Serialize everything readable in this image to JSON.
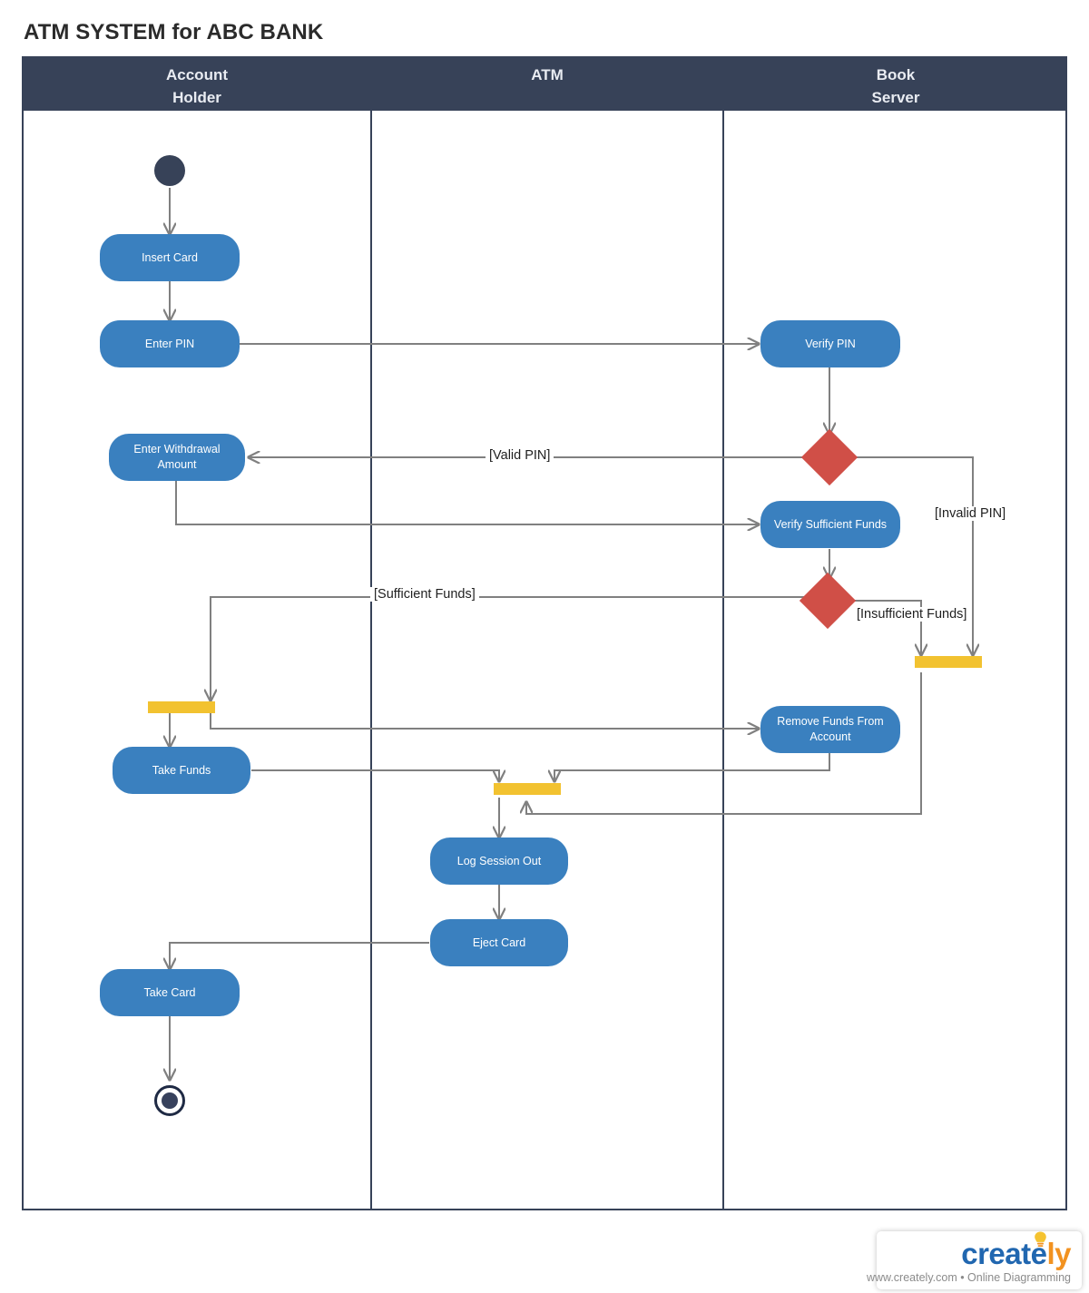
{
  "title": "ATM SYSTEM for ABC BANK",
  "colors": {
    "header_band": "#374258",
    "activity_fill": "#3a80bf",
    "decision_fill": "#d04f47",
    "bar_fill": "#f2c230",
    "connector": "#808080",
    "frame_border": "#374258",
    "logo_blue": "#2167b0",
    "logo_orange": "#f29220"
  },
  "lanes": [
    {
      "id": "account-holder",
      "label": "Account\nHolder"
    },
    {
      "id": "atm",
      "label": "ATM"
    },
    {
      "id": "book-server",
      "label": "Book\nServer"
    }
  ],
  "nodes": {
    "start": {
      "type": "initial-node",
      "lane": "account-holder"
    },
    "insert_card": {
      "label": "Insert Card",
      "lane": "account-holder"
    },
    "enter_pin": {
      "label": "Enter PIN",
      "lane": "account-holder"
    },
    "verify_pin": {
      "label": "Verify PIN",
      "lane": "book-server"
    },
    "decision_pin": {
      "type": "decision-node",
      "lane": "book-server"
    },
    "enter_withdrawal_amount": {
      "label": "Enter Withdrawal Amount",
      "lane": "account-holder"
    },
    "verify_sufficient_funds": {
      "label": "Verify Sufficient Funds",
      "lane": "book-server"
    },
    "decision_funds": {
      "type": "decision-node",
      "lane": "book-server"
    },
    "bar_left": {
      "type": "join-bar",
      "lane": "account-holder"
    },
    "bar_right": {
      "type": "join-bar",
      "lane": "book-server"
    },
    "bar_center": {
      "type": "join-bar",
      "lane": "atm"
    },
    "take_funds": {
      "label": "Take Funds",
      "lane": "account-holder"
    },
    "remove_funds": {
      "label": "Remove Funds From Account",
      "lane": "book-server"
    },
    "log_session_out": {
      "label": "Log Session Out",
      "lane": "atm"
    },
    "eject_card": {
      "label": "Eject Card",
      "lane": "atm"
    },
    "take_card": {
      "label": "Take Card",
      "lane": "account-holder"
    },
    "end": {
      "type": "final-node",
      "lane": "account-holder"
    }
  },
  "edge_labels": {
    "valid_pin": "[Valid PIN]",
    "invalid_pin": "[Invalid PIN]",
    "sufficient_funds": "[Sufficient Funds]",
    "insufficient_funds": "[Insufficient Funds]"
  },
  "logo": {
    "word_part1": "create",
    "word_part2": "ly",
    "tagline": "www.creately.com • Online Diagramming"
  }
}
